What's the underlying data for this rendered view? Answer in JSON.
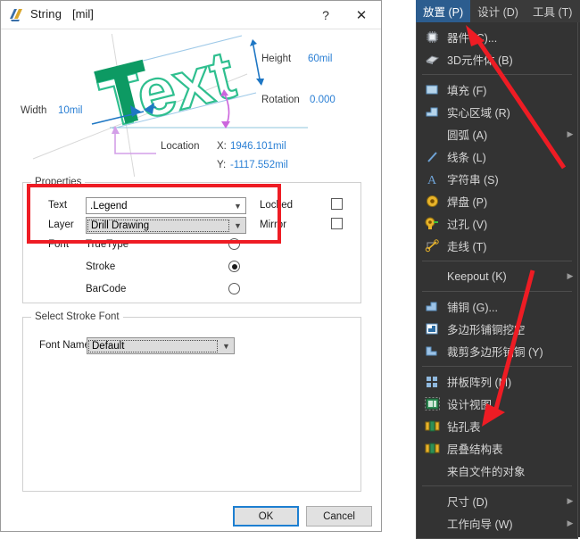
{
  "dialog": {
    "title": "String",
    "units": "[mil]",
    "help_label": "?",
    "close_label": "✕",
    "preview": {
      "sample_text": "Text",
      "height_label": "Height",
      "height_value": "60mil",
      "rotation_label": "Rotation",
      "rotation_value": "0.000",
      "width_label": "Width",
      "width_value": "10mil",
      "location_label": "Location",
      "x_label": "X:",
      "x_value": "1946.101mil",
      "y_label": "Y:",
      "y_value": "-1117.552mil"
    },
    "properties": {
      "group_title": "Properties",
      "text_label": "Text",
      "text_value": ".Legend",
      "layer_label": "Layer",
      "layer_value": "Drill Drawing",
      "locked_label": "Locked",
      "locked_checked": false,
      "mirror_label": "Mirror",
      "mirror_checked": false,
      "font_label": "Font",
      "font_options": [
        {
          "label": "TrueType",
          "selected": false
        },
        {
          "label": "Stroke",
          "selected": true
        },
        {
          "label": "BarCode",
          "selected": false
        }
      ]
    },
    "stroke_font": {
      "group_title": "Select Stroke Font",
      "font_name_label": "Font Name",
      "font_name_value": "Default"
    },
    "buttons": {
      "ok": "OK",
      "cancel": "Cancel"
    }
  },
  "menu": {
    "bar": [
      {
        "label": "放置 (P)",
        "active": true
      },
      {
        "label": "设计 (D)",
        "active": false
      },
      {
        "label": "工具 (T)",
        "active": false
      }
    ],
    "items": [
      {
        "label": "器件 (C)...",
        "icon": "chip-icon",
        "submenu": false,
        "sep_after": false
      },
      {
        "label": "3D元件体 (B)",
        "icon": "component-3d-icon",
        "submenu": false,
        "sep_after": true
      },
      {
        "label": "填充 (F)",
        "icon": "fill-icon",
        "submenu": false,
        "sep_after": false
      },
      {
        "label": "实心区域 (R)",
        "icon": "solid-region-icon",
        "submenu": false,
        "sep_after": false
      },
      {
        "label": "圆弧 (A)",
        "icon": "none",
        "submenu": true,
        "sep_after": false
      },
      {
        "label": "线条 (L)",
        "icon": "line-icon",
        "submenu": false,
        "sep_after": false
      },
      {
        "label": "字符串 (S)",
        "icon": "string-icon",
        "submenu": false,
        "sep_after": false
      },
      {
        "label": "焊盘 (P)",
        "icon": "pad-icon",
        "submenu": false,
        "sep_after": false
      },
      {
        "label": "过孔 (V)",
        "icon": "via-icon",
        "submenu": false,
        "sep_after": false
      },
      {
        "label": "走线 (T)",
        "icon": "track-icon",
        "submenu": false,
        "sep_after": true
      },
      {
        "label": "Keepout (K)",
        "icon": "none",
        "submenu": true,
        "sep_after": true
      },
      {
        "label": "铺铜 (G)...",
        "icon": "polygon-pour-icon",
        "submenu": false,
        "sep_after": false
      },
      {
        "label": "多边形铺铜挖空",
        "icon": "polygon-cutout-icon",
        "submenu": false,
        "sep_after": false
      },
      {
        "label": "裁剪多边形铺铜 (Y)",
        "icon": "polygon-slice-icon",
        "submenu": false,
        "sep_after": true
      },
      {
        "label": "拼板阵列 (M)",
        "icon": "panel-array-icon",
        "submenu": false,
        "sep_after": false
      },
      {
        "label": "设计视图",
        "icon": "design-view-icon",
        "submenu": false,
        "sep_after": false
      },
      {
        "label": "钻孔表",
        "icon": "drill-table-icon",
        "submenu": false,
        "sep_after": false
      },
      {
        "label": "层叠结构表",
        "icon": "layer-stack-table-icon",
        "submenu": false,
        "sep_after": false
      },
      {
        "label": "来自文件的对象",
        "icon": "none",
        "submenu": false,
        "sep_after": true
      },
      {
        "label": "尺寸 (D)",
        "icon": "none",
        "submenu": true,
        "sep_after": false
      },
      {
        "label": "工作向导 (W)",
        "icon": "none",
        "submenu": true,
        "sep_after": false
      }
    ]
  },
  "annotations": {
    "arrow_color": "#ee1c24",
    "highlight_box_color": "#ee1c24"
  }
}
